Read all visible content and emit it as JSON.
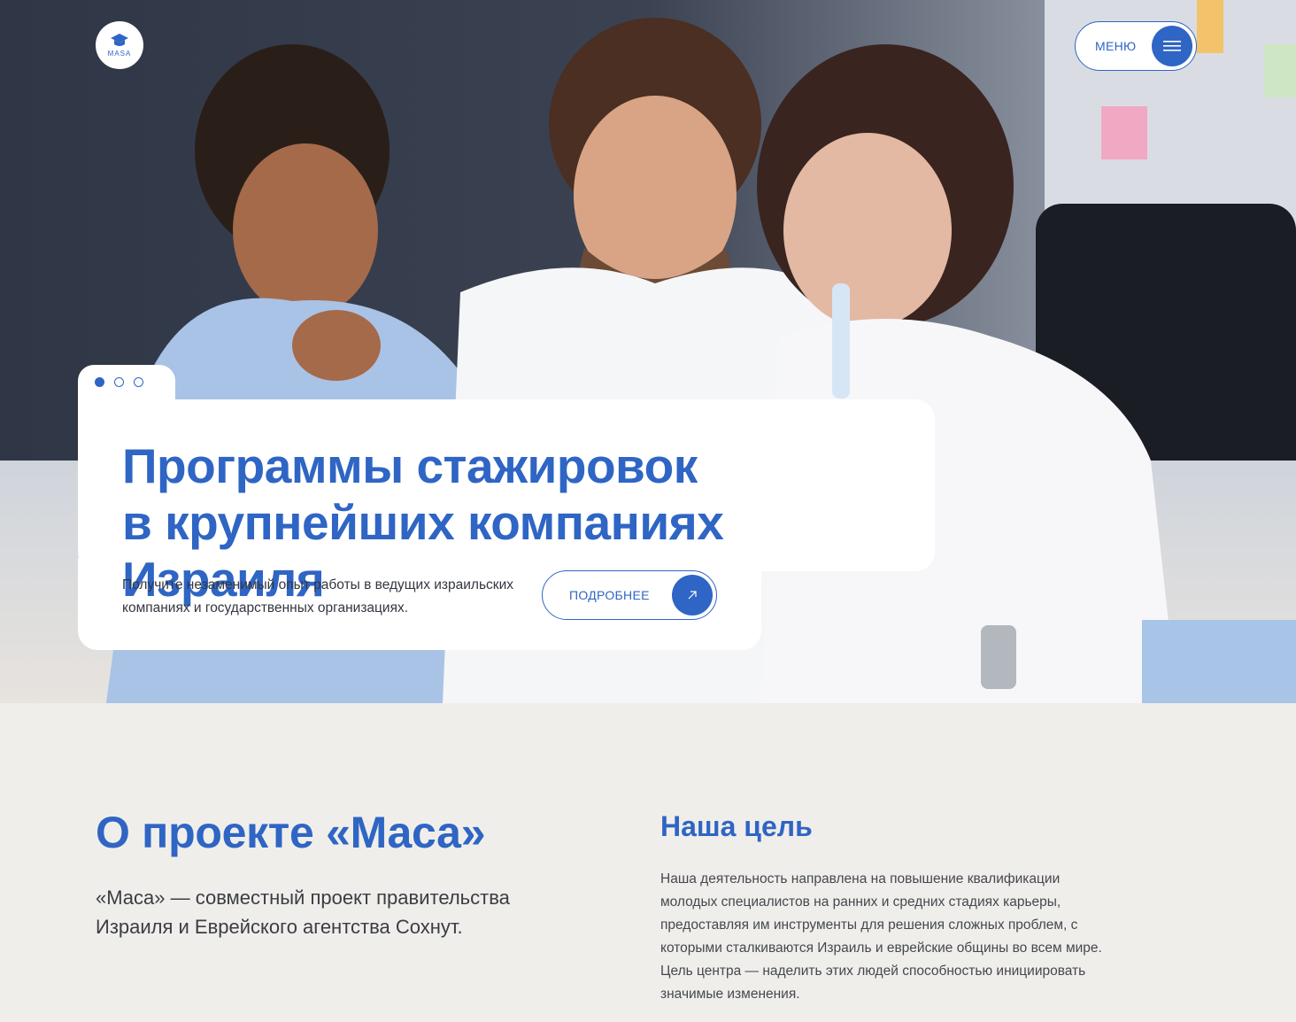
{
  "header": {
    "logo_text": "MASA",
    "menu_label": "МЕНЮ"
  },
  "hero": {
    "title_line1": "Программы стажировок",
    "title_line2": "в крупнейших компаниях Израиля",
    "subtitle": "Получите незаменимый опыт работы в ведущих израильских компаниях и государственных организациях.",
    "cta_label": "ПОДРОБНЕЕ",
    "slides_total": 3,
    "slide_active": 1
  },
  "about": {
    "title": "О проекте «Маса»",
    "text": "«Маса» — совместный проект правительства Израиля и Еврейского агентства Сохнут."
  },
  "goal": {
    "title": "Наша цель",
    "text": "Наша деятельность направлена на повышение квалификации молодых специалистов на ранних и средних стадиях карьеры, предоставляя им инструменты для решения сложных проблем, с которыми сталкиваются Израиль и еврейские общины во всем мире. Цель центра — наделить этих людей способностью инициировать значимые изменения."
  },
  "colors": {
    "accent": "#2f65c4",
    "background": "#f0eeea",
    "text": "#3a3d45"
  },
  "icons": {
    "logo": "graduation-cap-icon",
    "menu": "hamburger-icon",
    "cta": "arrow-up-right-icon"
  }
}
